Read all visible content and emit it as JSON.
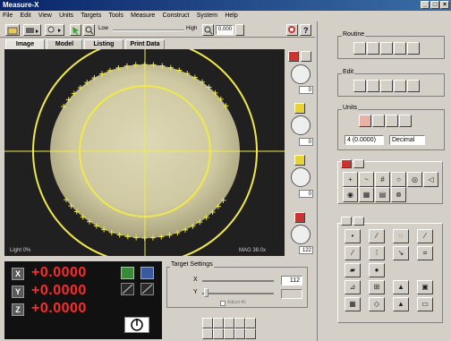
{
  "window": {
    "title": "Measure-X"
  },
  "menu": [
    "File",
    "Edit",
    "View",
    "Units",
    "Targets",
    "Tools",
    "Measure",
    "Construct",
    "System",
    "Help"
  ],
  "toolbar": {
    "slider_low": "Low",
    "slider_high": "High",
    "zoom_value": "0.000"
  },
  "tabs": [
    "Image",
    "Model",
    "Listing",
    "Print Data"
  ],
  "image_view": {
    "light": "Light  0%",
    "mag": "MAG 38.0x"
  },
  "side_fields": [
    "0",
    "0",
    "0",
    "0",
    "122"
  ],
  "dro": {
    "axes": [
      {
        "axis": "X",
        "value": "+0.0000"
      },
      {
        "axis": "Y",
        "value": "+0.0000"
      },
      {
        "axis": "Z",
        "value": "+0.0000"
      }
    ]
  },
  "target": {
    "title": "Target Settings",
    "x_label": "X",
    "y_label": "Y",
    "x_value": "112",
    "y_value": "",
    "checkbox_label": "Adjust All"
  },
  "right_panel": {
    "routine_label": "Routine",
    "edit_label": "Edit",
    "units_label": "Units",
    "units_precision": "4 (0.0000)",
    "units_format": "Decimal"
  },
  "colors": {
    "dro_value": "#ff2a2a",
    "image_bg": "#202020",
    "ring": "#f1e94a",
    "part": "#cfc9a3",
    "title_start": "#0a246a",
    "title_end": "#3a6ea5"
  }
}
